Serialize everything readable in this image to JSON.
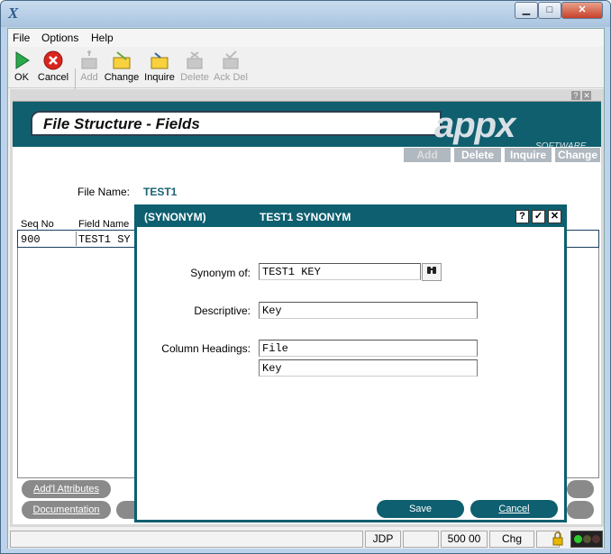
{
  "window": {
    "app_icon": "X",
    "buttons": {
      "minimize": "▁",
      "maximize": "□",
      "close": "✕"
    }
  },
  "menu": [
    "File",
    "Options",
    "Help"
  ],
  "toolbar": {
    "ok": "OK",
    "cancel": "Cancel",
    "add": "Add",
    "change": "Change",
    "inquire": "Inquire",
    "delete": "Delete",
    "ack_del": "Ack Del"
  },
  "frame_help": {
    "help": "?",
    "close": "✕"
  },
  "screen": {
    "title": "File Structure - Fields",
    "logo": "appx",
    "logo_sub": "SOFTWARE",
    "actions": [
      "Add",
      "Delete",
      "Inquire",
      "Change"
    ],
    "file_name_label": "File Name:",
    "file_name_value": "TEST1",
    "columns": {
      "seq": "Seq No",
      "field": "Field Name"
    },
    "row": {
      "seq": "900",
      "field": "TEST1 SY"
    },
    "bottom_buttons": [
      "Add'l Attributes",
      "Documentation"
    ]
  },
  "status": {
    "user": "JDP",
    "code": "500 00",
    "mode": "Chg"
  },
  "dialog": {
    "tag": "(SYNONYM)",
    "name": "TEST1 SYNONYM",
    "buttons": {
      "help": "?",
      "ok": "✓",
      "close": "✕"
    },
    "synonym_label": "Synonym of:",
    "synonym_value": "TEST1 KEY",
    "descriptive_label": "Descriptive:",
    "descriptive_value": "Key",
    "headings_label": "Column Headings:",
    "heading1": "File",
    "heading2": "Key",
    "save": "Save",
    "cancel": "Cancel"
  }
}
